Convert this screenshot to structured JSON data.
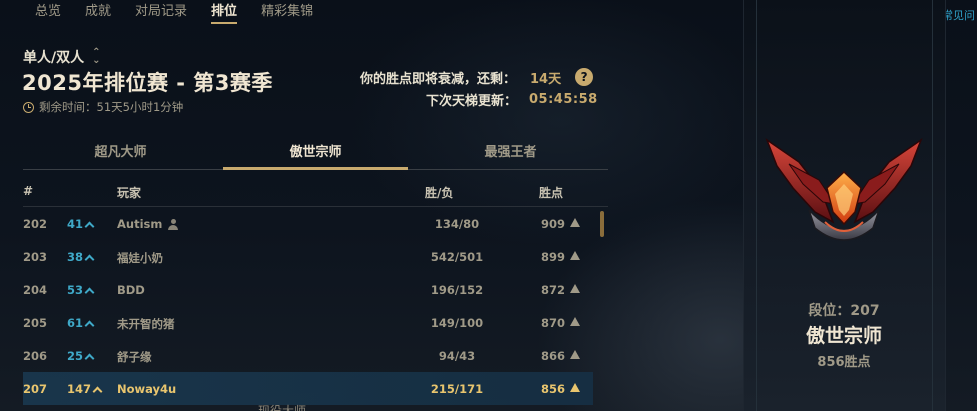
{
  "nav": {
    "tabs": [
      "总览",
      "成就",
      "对局记录",
      "排位",
      "精彩集锦"
    ],
    "active_index": 3
  },
  "corner_link": "战区系统常见问",
  "queue": {
    "label": "单人/双人"
  },
  "season": {
    "title": "2025年排位赛 - 第3赛季",
    "time_left": "剩余时间：51天5小时1分钟"
  },
  "decay": {
    "label": "你的胜点即将衰减，还剩：",
    "value": "14天",
    "help_icon": "?",
    "ladder_label": "下次天梯更新：",
    "ladder_value": "05:45:58"
  },
  "tier_tabs": [
    "超凡大师",
    "傲世宗师",
    "最强王者"
  ],
  "tier_tab_active": 1,
  "table": {
    "headers": {
      "rank": "#",
      "player": "玩家",
      "wl": "胜/负",
      "lp": "胜点"
    },
    "rows": [
      {
        "rank": "202",
        "change": "41",
        "name": "Autism",
        "wl": "134/80",
        "lp": "909",
        "profile_icon": true
      },
      {
        "rank": "203",
        "change": "38",
        "name": "福娃小奶",
        "wl": "542/501",
        "lp": "899"
      },
      {
        "rank": "204",
        "change": "53",
        "name": "BDD",
        "wl": "196/152",
        "lp": "872"
      },
      {
        "rank": "205",
        "change": "61",
        "name": "未开智的猪",
        "wl": "149/100",
        "lp": "870"
      },
      {
        "rank": "206",
        "change": "25",
        "name": "舒子缘",
        "wl": "94/43",
        "lp": "866"
      },
      {
        "rank": "207",
        "change": "147",
        "name": "Noway4u",
        "wl": "215/171",
        "lp": "856",
        "is_me": true
      }
    ]
  },
  "panel": {
    "tier_label": "段位：207",
    "tier_name": "傲世宗师",
    "tier_lp": "856胜点",
    "emblem_icon": "grandmaster-emblem-icon"
  },
  "bottom_cut": "现役大师"
}
